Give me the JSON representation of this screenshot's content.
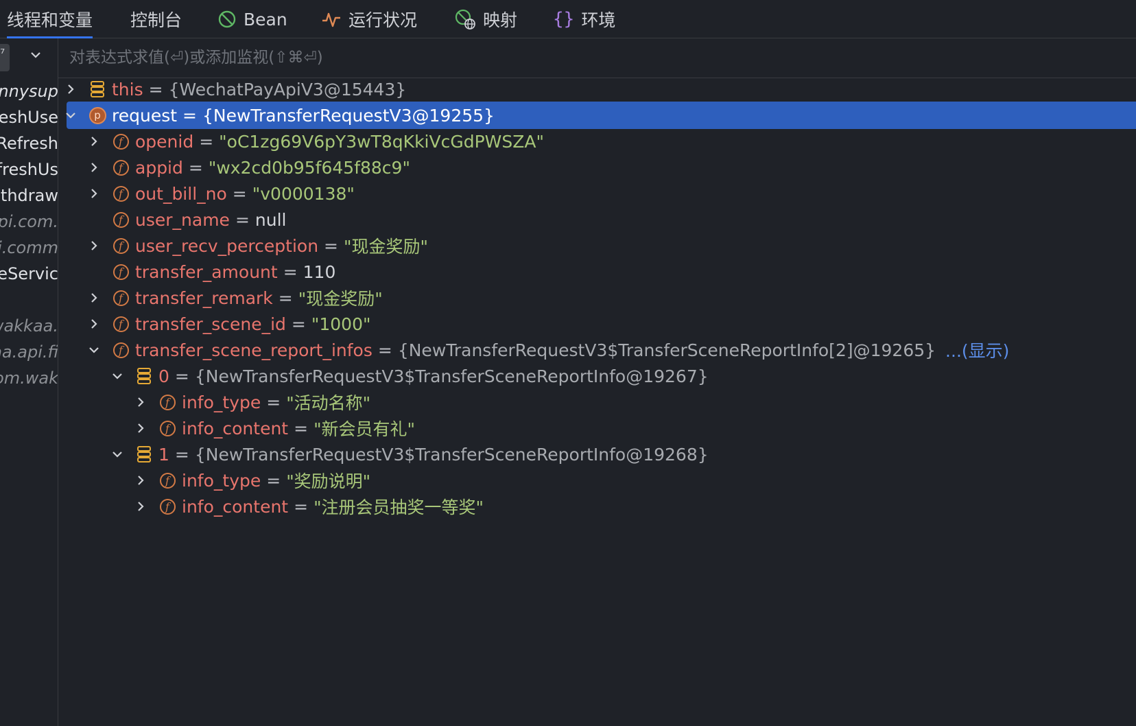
{
  "tabs": [
    {
      "label": "线程和变量",
      "icon": "none",
      "active": true
    },
    {
      "label": "控制台",
      "icon": "none",
      "active": false
    },
    {
      "label": "Bean",
      "icon": "bean-icon",
      "active": false
    },
    {
      "label": "运行状况",
      "icon": "health-icon",
      "active": false
    },
    {
      "label": "映射",
      "icon": "mapping-icon",
      "active": false
    },
    {
      "label": "环境",
      "icon": "braces-icon",
      "active": false
    }
  ],
  "colors": {
    "accent": "#3574f0",
    "selection": "#2e5fbd",
    "name": "#e8756d",
    "string": "#a8c779",
    "field_badge": "#d37a45"
  },
  "evaluate": {
    "placeholder": "对表达式求值(⏎)或添加监视(⇧⌘⏎)",
    "value": ""
  },
  "threads": [
    {
      "text": "sunnysup",
      "style": "italic-bright"
    },
    {
      "text": "RefreshUse",
      "style": "normal"
    },
    {
      "text": "Refresh",
      "style": "normal"
    },
    {
      "text": "RefreshUs",
      "style": "normal"
    },
    {
      "text": "Withdraw",
      "style": "normal"
    },
    {
      "text": "api.com.",
      "style": "italic"
    },
    {
      "text": "api.comm",
      "style": "italic"
    },
    {
      "text": "eServic",
      "style": "normal"
    },
    {
      "text": "",
      "style": "normal"
    },
    {
      "text": "wakkaa.",
      "style": "italic"
    },
    {
      "text": "kaa.api.fi",
      "style": "italic"
    },
    {
      "text": "com.wak",
      "style": "italic"
    }
  ],
  "variables": [
    {
      "name": "this",
      "value": "{WechatPayApiV3@15443}",
      "kind": "obj",
      "icon": "stack-icon",
      "depth": 0,
      "arrow": "right",
      "selected": false
    },
    {
      "name": "request",
      "value": "{NewTransferRequestV3@19255}",
      "kind": "obj",
      "icon": "param-icon",
      "depth": 0,
      "arrow": "down",
      "selected": true
    },
    {
      "name": "openid",
      "value": "\"oC1zg69V6pY3wT8qKkiVcGdPWSZA\"",
      "kind": "str",
      "icon": "field-icon",
      "depth": 1,
      "arrow": "right",
      "selected": false
    },
    {
      "name": "appid",
      "value": "\"wx2cd0b95f645f88c9\"",
      "kind": "str",
      "icon": "field-icon",
      "depth": 1,
      "arrow": "right",
      "selected": false
    },
    {
      "name": "out_bill_no",
      "value": "\"v0000138\"",
      "kind": "str",
      "icon": "field-icon",
      "depth": 1,
      "arrow": "right",
      "selected": false
    },
    {
      "name": "user_name",
      "value": "null",
      "kind": "plain",
      "icon": "field-icon",
      "depth": 1,
      "arrow": "none",
      "selected": false
    },
    {
      "name": "user_recv_perception",
      "value": "\"现金奖励\"",
      "kind": "str",
      "icon": "field-icon",
      "depth": 1,
      "arrow": "right",
      "selected": false
    },
    {
      "name": "transfer_amount",
      "value": "110",
      "kind": "plain",
      "icon": "field-icon",
      "depth": 1,
      "arrow": "none",
      "selected": false
    },
    {
      "name": "transfer_remark",
      "value": "\"现金奖励\"",
      "kind": "str",
      "icon": "field-icon",
      "depth": 1,
      "arrow": "right",
      "selected": false
    },
    {
      "name": "transfer_scene_id",
      "value": "\"1000\"",
      "kind": "str",
      "icon": "field-icon",
      "depth": 1,
      "arrow": "right",
      "selected": false
    },
    {
      "name": "transfer_scene_report_infos",
      "value": "{NewTransferRequestV3$TransferSceneReportInfo[2]@19265}",
      "kind": "obj",
      "icon": "field-icon",
      "depth": 1,
      "arrow": "down",
      "selected": false,
      "link": "...(显示)"
    },
    {
      "name": "0",
      "value": "{NewTransferRequestV3$TransferSceneReportInfo@19267}",
      "kind": "obj",
      "icon": "stack-icon",
      "depth": 2,
      "arrow": "down",
      "selected": false
    },
    {
      "name": "info_type",
      "value": "\"活动名称\"",
      "kind": "str",
      "icon": "field-icon",
      "depth": 3,
      "arrow": "right",
      "selected": false
    },
    {
      "name": "info_content",
      "value": "\"新会员有礼\"",
      "kind": "str",
      "icon": "field-icon",
      "depth": 3,
      "arrow": "right",
      "selected": false
    },
    {
      "name": "1",
      "value": "{NewTransferRequestV3$TransferSceneReportInfo@19268}",
      "kind": "obj",
      "icon": "stack-icon",
      "depth": 2,
      "arrow": "down",
      "selected": false
    },
    {
      "name": "info_type",
      "value": "\"奖励说明\"",
      "kind": "str",
      "icon": "field-icon",
      "depth": 3,
      "arrow": "right",
      "selected": false
    },
    {
      "name": "info_content",
      "value": "\"注册会员抽奖一等奖\"",
      "kind": "str",
      "icon": "field-icon",
      "depth": 3,
      "arrow": "right",
      "selected": false
    }
  ]
}
